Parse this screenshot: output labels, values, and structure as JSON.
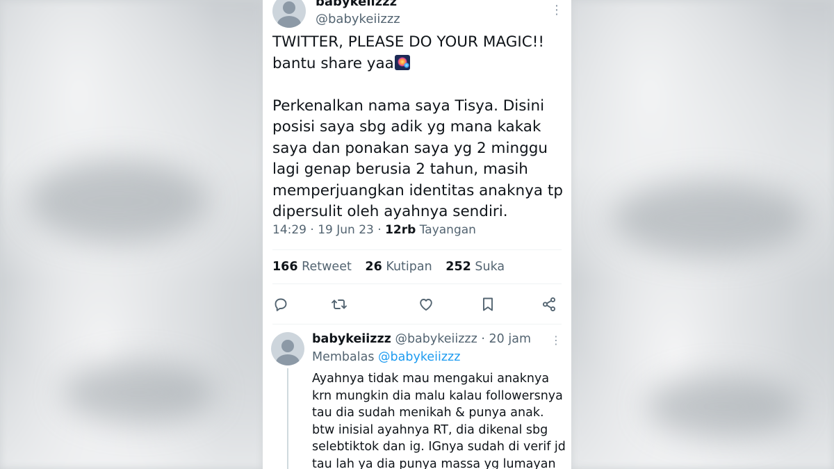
{
  "tweet": {
    "display_name": "babykeiizzz",
    "handle": "@babykeiizzz",
    "text": "TWITTER, PLEASE DO YOUR MAGIC!!\nbantu share yaa",
    "emoji": "fireworks",
    "text_body": "Perkenalkan nama saya Tisya. Disini posisi saya sbg adik yg mana kakak saya dan ponakan saya yg 2 minggu lagi genap berusia 2 tahun, masih memperjuangkan identitas anaknya tp dipersulit oleh ayahnya sendiri.",
    "time": "14:29",
    "date": "19 Jun 23",
    "views_count": "12rb",
    "views_label": "Tayangan",
    "separator": "·"
  },
  "stats": {
    "retweets_count": "166",
    "retweets_label": "Retweet",
    "quotes_count": "26",
    "quotes_label": "Kutipan",
    "likes_count": "252",
    "likes_label": "Suka"
  },
  "actions": [
    "reply-icon",
    "retweet-icon",
    "like-icon",
    "bookmark-icon",
    "share-icon"
  ],
  "reply": {
    "display_name": "babykeiizzz",
    "handle": "@babykeiizzz",
    "time_ago": "20 jam",
    "replying_label": "Membalas",
    "replying_to": "@babykeiizzz",
    "text": "Ayahnya tidak mau mengakui anaknya krn mungkin dia malu kalau followersnya tau dia sudah menikah & punya anak. btw inisial ayahnya RT, dia dikenal sbg selebtiktok dan ig. IGnya sudah di verif jd tau lah ya dia punya massa yg lumayan"
  },
  "colors": {
    "text_primary": "#0f1419",
    "text_secondary": "#536471",
    "link": "#1d9bf0",
    "divider": "#eff3f4"
  }
}
